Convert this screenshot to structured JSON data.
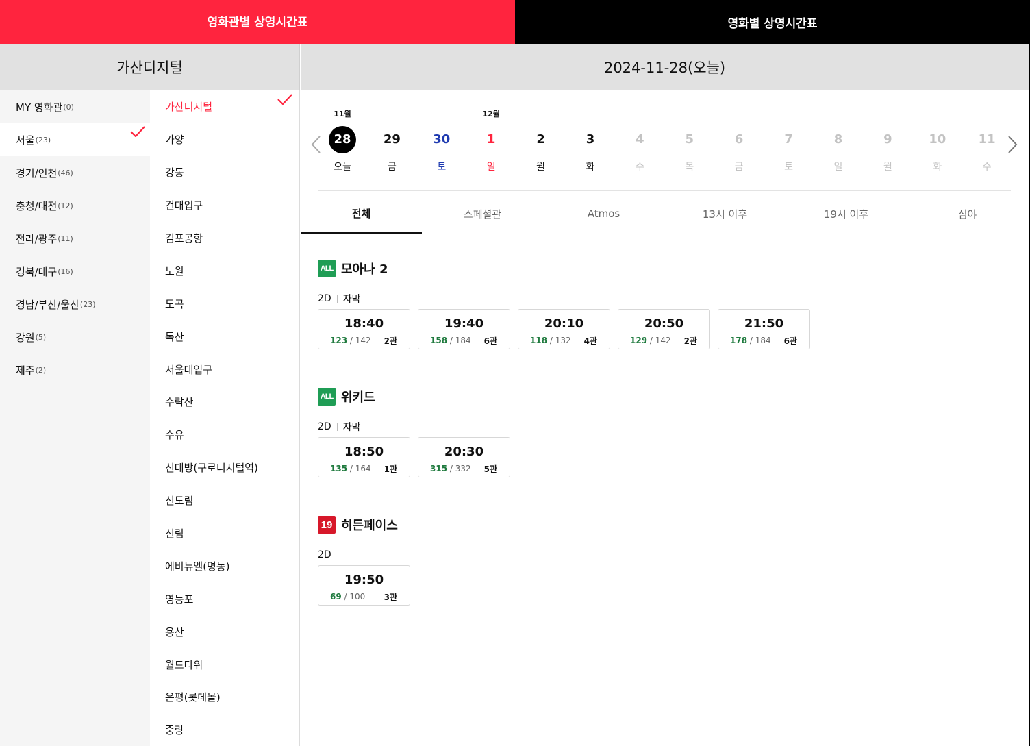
{
  "top_tabs": {
    "by_theater": "영화관별 상영시간표",
    "by_movie": "영화별 상영시간표"
  },
  "left_header": "가산디지털",
  "right_header": "2024-11-28(오늘)",
  "regions": [
    {
      "name": "MY 영화관",
      "count": "(0)"
    },
    {
      "name": "서울",
      "count": "(23)"
    },
    {
      "name": "경기/인천",
      "count": "(46)"
    },
    {
      "name": "충청/대전",
      "count": "(12)"
    },
    {
      "name": "전라/광주",
      "count": "(11)"
    },
    {
      "name": "경북/대구",
      "count": "(16)"
    },
    {
      "name": "경남/부산/울산",
      "count": "(23)"
    },
    {
      "name": "강원",
      "count": "(5)"
    },
    {
      "name": "제주",
      "count": "(2)"
    }
  ],
  "theaters": [
    "가산디지털",
    "가양",
    "강동",
    "건대입구",
    "김포공항",
    "노원",
    "도곡",
    "독산",
    "서울대입구",
    "수락산",
    "수유",
    "신대방(구로디지털역)",
    "신도림",
    "신림",
    "에비뉴엘(명동)",
    "영등포",
    "용산",
    "월드타워",
    "은평(롯데몰)",
    "중랑"
  ],
  "dates": [
    {
      "month": "11월",
      "day": "28",
      "wd": "오늘",
      "kind": "today"
    },
    {
      "month": "",
      "day": "29",
      "wd": "금",
      "kind": "normal"
    },
    {
      "month": "",
      "day": "30",
      "wd": "토",
      "kind": "sat"
    },
    {
      "month": "12월",
      "day": "1",
      "wd": "일",
      "kind": "sun"
    },
    {
      "month": "",
      "day": "2",
      "wd": "월",
      "kind": "normal"
    },
    {
      "month": "",
      "day": "3",
      "wd": "화",
      "kind": "normal"
    },
    {
      "month": "",
      "day": "4",
      "wd": "수",
      "kind": "dis"
    },
    {
      "month": "",
      "day": "5",
      "wd": "목",
      "kind": "dis"
    },
    {
      "month": "",
      "day": "6",
      "wd": "금",
      "kind": "dis"
    },
    {
      "month": "",
      "day": "7",
      "wd": "토",
      "kind": "dis"
    },
    {
      "month": "",
      "day": "8",
      "wd": "일",
      "kind": "dis"
    },
    {
      "month": "",
      "day": "9",
      "wd": "월",
      "kind": "dis"
    },
    {
      "month": "",
      "day": "10",
      "wd": "화",
      "kind": "dis"
    },
    {
      "month": "",
      "day": "11",
      "wd": "수",
      "kind": "dis"
    }
  ],
  "filters": [
    "전체",
    "스페셜관",
    "Atmos",
    "13시 이후",
    "19시 이후",
    "심야"
  ],
  "movies": [
    {
      "rating": "ALL",
      "title": "모아나 2",
      "format": "2D",
      "subtitle": "자막",
      "slots": [
        {
          "time": "18:40",
          "remain": "123",
          "total": "/ 142",
          "screen": "2관"
        },
        {
          "time": "19:40",
          "remain": "158",
          "total": "/ 184",
          "screen": "6관"
        },
        {
          "time": "20:10",
          "remain": "118",
          "total": "/ 132",
          "screen": "4관"
        },
        {
          "time": "20:50",
          "remain": "129",
          "total": "/ 142",
          "screen": "2관"
        },
        {
          "time": "21:50",
          "remain": "178",
          "total": "/ 184",
          "screen": "6관"
        }
      ]
    },
    {
      "rating": "ALL",
      "title": "위키드",
      "format": "2D",
      "subtitle": "자막",
      "slots": [
        {
          "time": "18:50",
          "remain": "135",
          "total": "/ 164",
          "screen": "1관"
        },
        {
          "time": "20:30",
          "remain": "315",
          "total": "/ 332",
          "screen": "5관"
        }
      ]
    },
    {
      "rating": "19",
      "title": "히든페이스",
      "format": "2D",
      "subtitle": "",
      "slots": [
        {
          "time": "19:50",
          "remain": "69",
          "total": "/ 100",
          "screen": "3관"
        }
      ]
    }
  ],
  "colors": {
    "accent": "#ff243e",
    "saturday": "#1e3ab0",
    "remain": "#1f7a3e",
    "rating_all": "#1f9d55",
    "rating_19": "#d7182a"
  }
}
